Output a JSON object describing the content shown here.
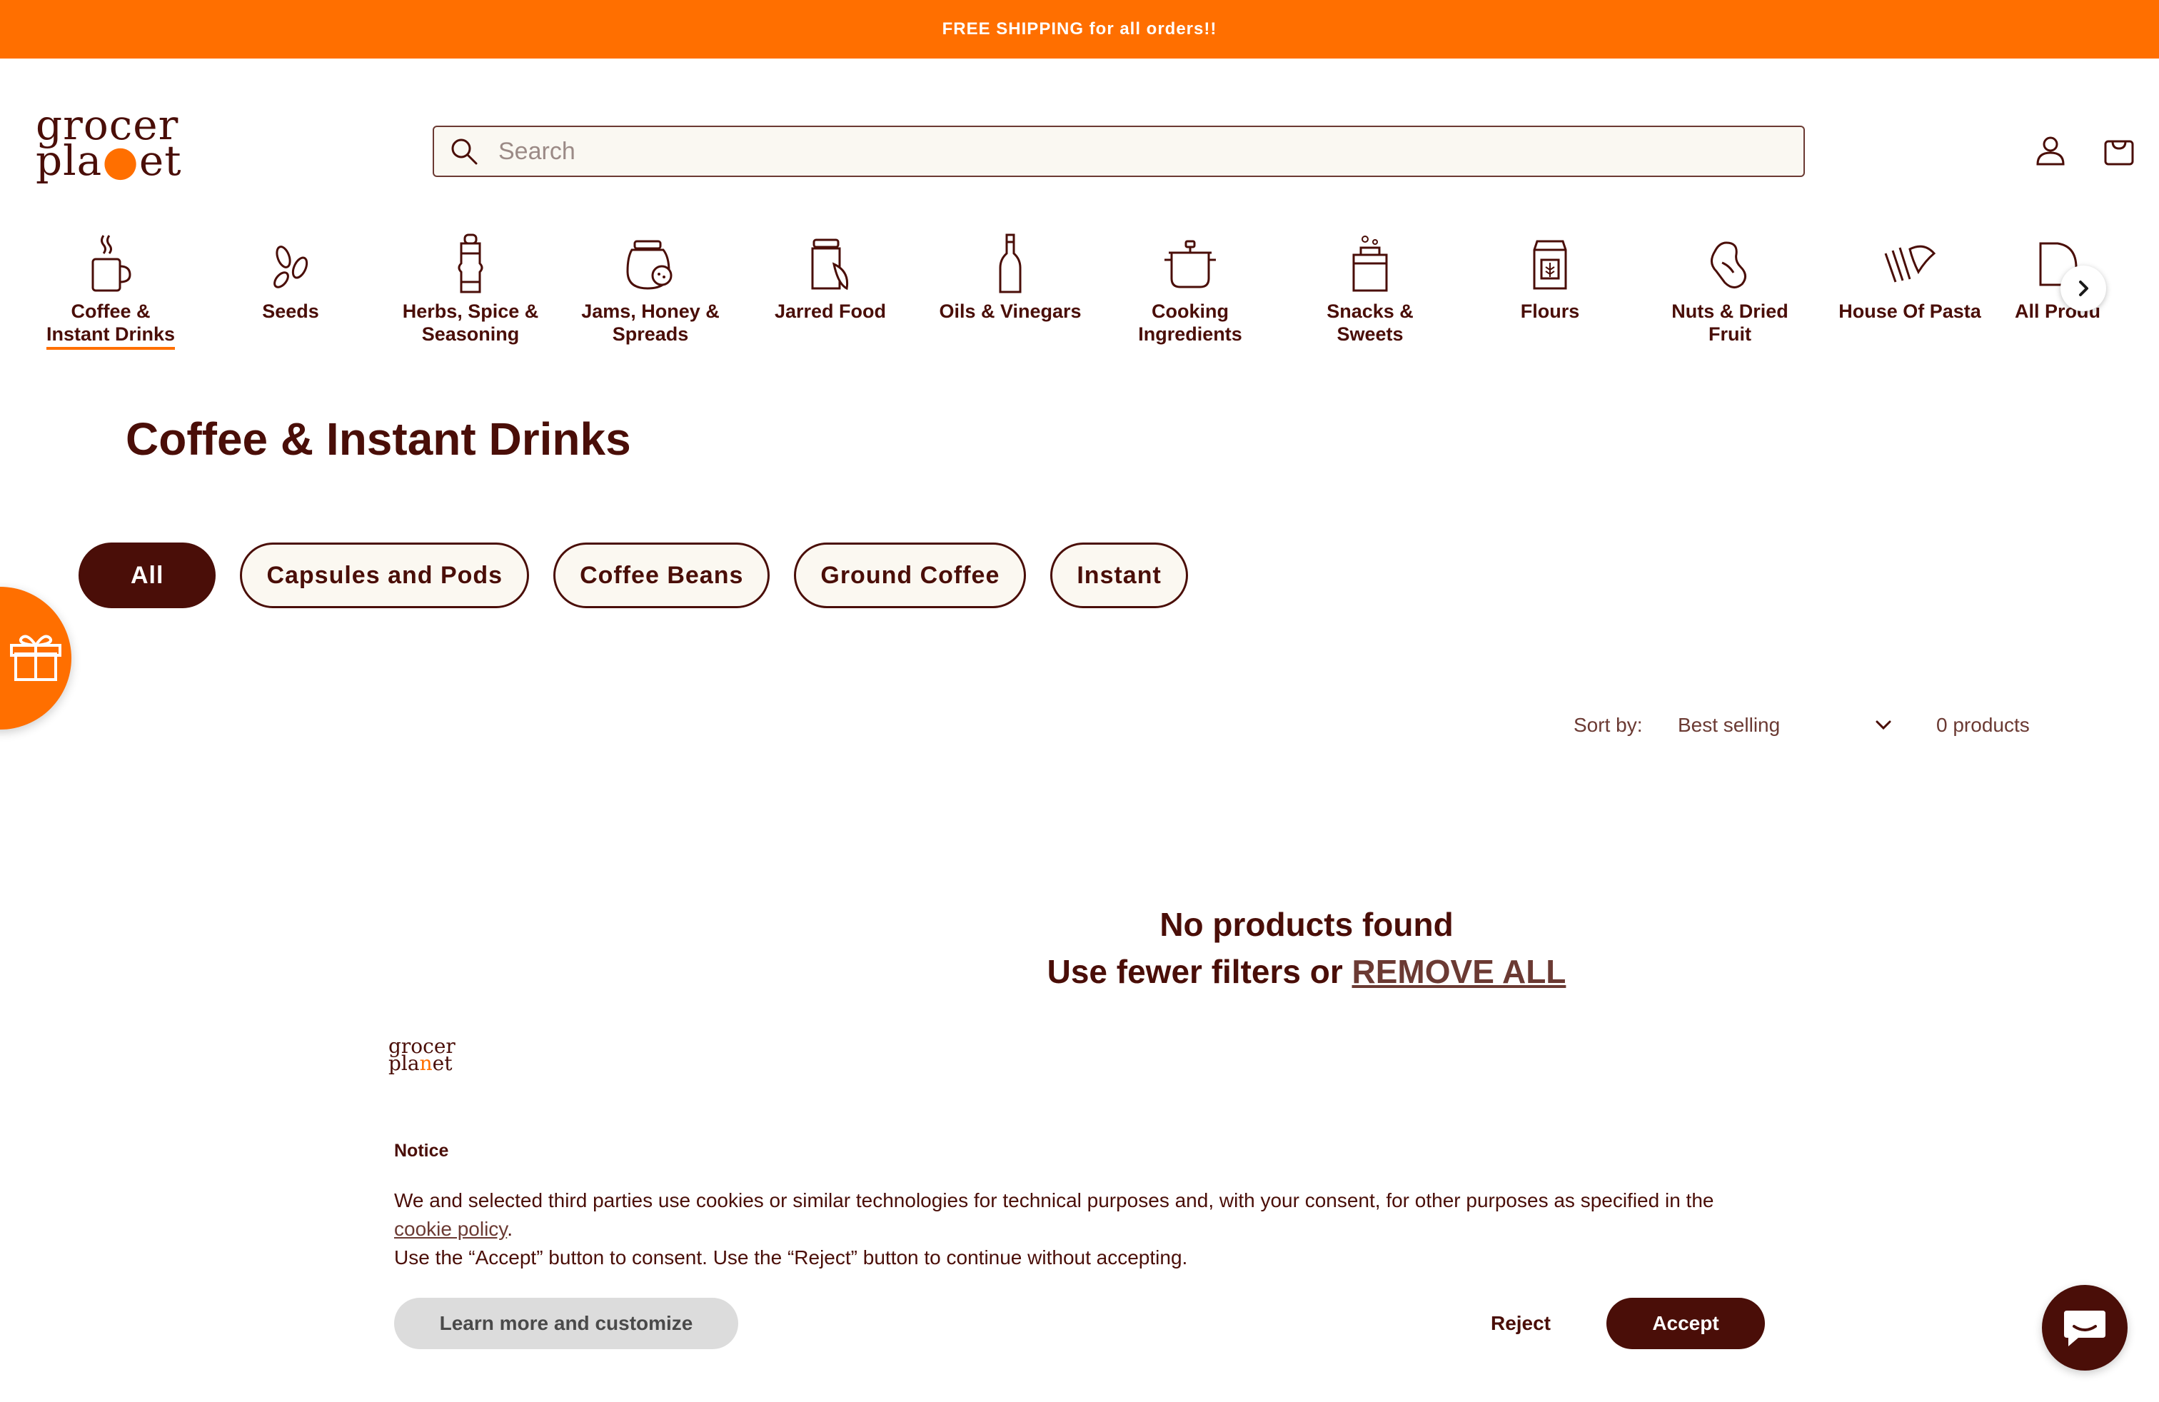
{
  "announcement": {
    "text": "FREE SHIPPING for all orders!!"
  },
  "header": {
    "logo_line1": "grocer",
    "logo_line2_a": "pla",
    "logo_line2_dot": "๏",
    "logo_line2_b": "et",
    "search_placeholder": "Search",
    "account_icon": "user-icon",
    "cart_icon": "bag-icon"
  },
  "categories": [
    {
      "label_1": "Coffee &",
      "label_2": "Instant Drinks",
      "icon": "coffee-cup-icon",
      "active": true
    },
    {
      "label_1": "Seeds",
      "label_2": "",
      "icon": "seeds-icon"
    },
    {
      "label_1": "Herbs, Spice &",
      "label_2": "Seasoning",
      "icon": "pepper-mill-icon"
    },
    {
      "label_1": "Jams, Honey &",
      "label_2": "Spreads",
      "icon": "jam-jar-icon"
    },
    {
      "label_1": "Jarred Food",
      "label_2": "",
      "icon": "jar-icon"
    },
    {
      "label_1": "Oils & Vinegars",
      "label_2": "",
      "icon": "bottle-icon"
    },
    {
      "label_1": "Cooking",
      "label_2": "Ingredients",
      "icon": "pot-icon"
    },
    {
      "label_1": "Snacks &",
      "label_2": "Sweets",
      "icon": "candy-jar-icon"
    },
    {
      "label_1": "Flours",
      "label_2": "",
      "icon": "flour-bag-icon"
    },
    {
      "label_1": "Nuts & Dried",
      "label_2": "Fruit",
      "icon": "peanut-icon"
    },
    {
      "label_1": "House Of Pasta",
      "label_2": "",
      "icon": "pasta-icon"
    },
    {
      "label_1": "All Produ",
      "label_2": "",
      "icon": "all-products-icon"
    }
  ],
  "page": {
    "title": "Coffee & Instant Drinks"
  },
  "filters": [
    {
      "label": "All",
      "active": true
    },
    {
      "label": "Capsules and Pods"
    },
    {
      "label": "Coffee Beans"
    },
    {
      "label": "Ground Coffee"
    },
    {
      "label": "Instant"
    }
  ],
  "sort": {
    "label": "Sort by:",
    "value": "Best selling",
    "count": "0 products"
  },
  "empty": {
    "line1": "No products found",
    "line2_prefix": "Use fewer filters or ",
    "link": "REMOVE ALL"
  },
  "cookie": {
    "logo_line1": "grocer",
    "logo_line2_a": "pla",
    "logo_line2_dot": "n",
    "logo_line2_b": "et",
    "title": "Notice",
    "body_1": "We and selected third parties use cookies or similar technologies for technical purposes and, with your consent, for other purposes as specified in the",
    "policy_link": "cookie policy",
    "body_2": "Use the “Accept” button to consent. Use the “Reject” button to continue without accepting.",
    "learn_button": "Learn more and customize",
    "reject_button": "Reject",
    "accept_button": "Accept"
  },
  "colors": {
    "brand_orange": "#ff6f00",
    "brand_brown": "#4a0e08",
    "pill_bg": "#fbf8f1"
  }
}
